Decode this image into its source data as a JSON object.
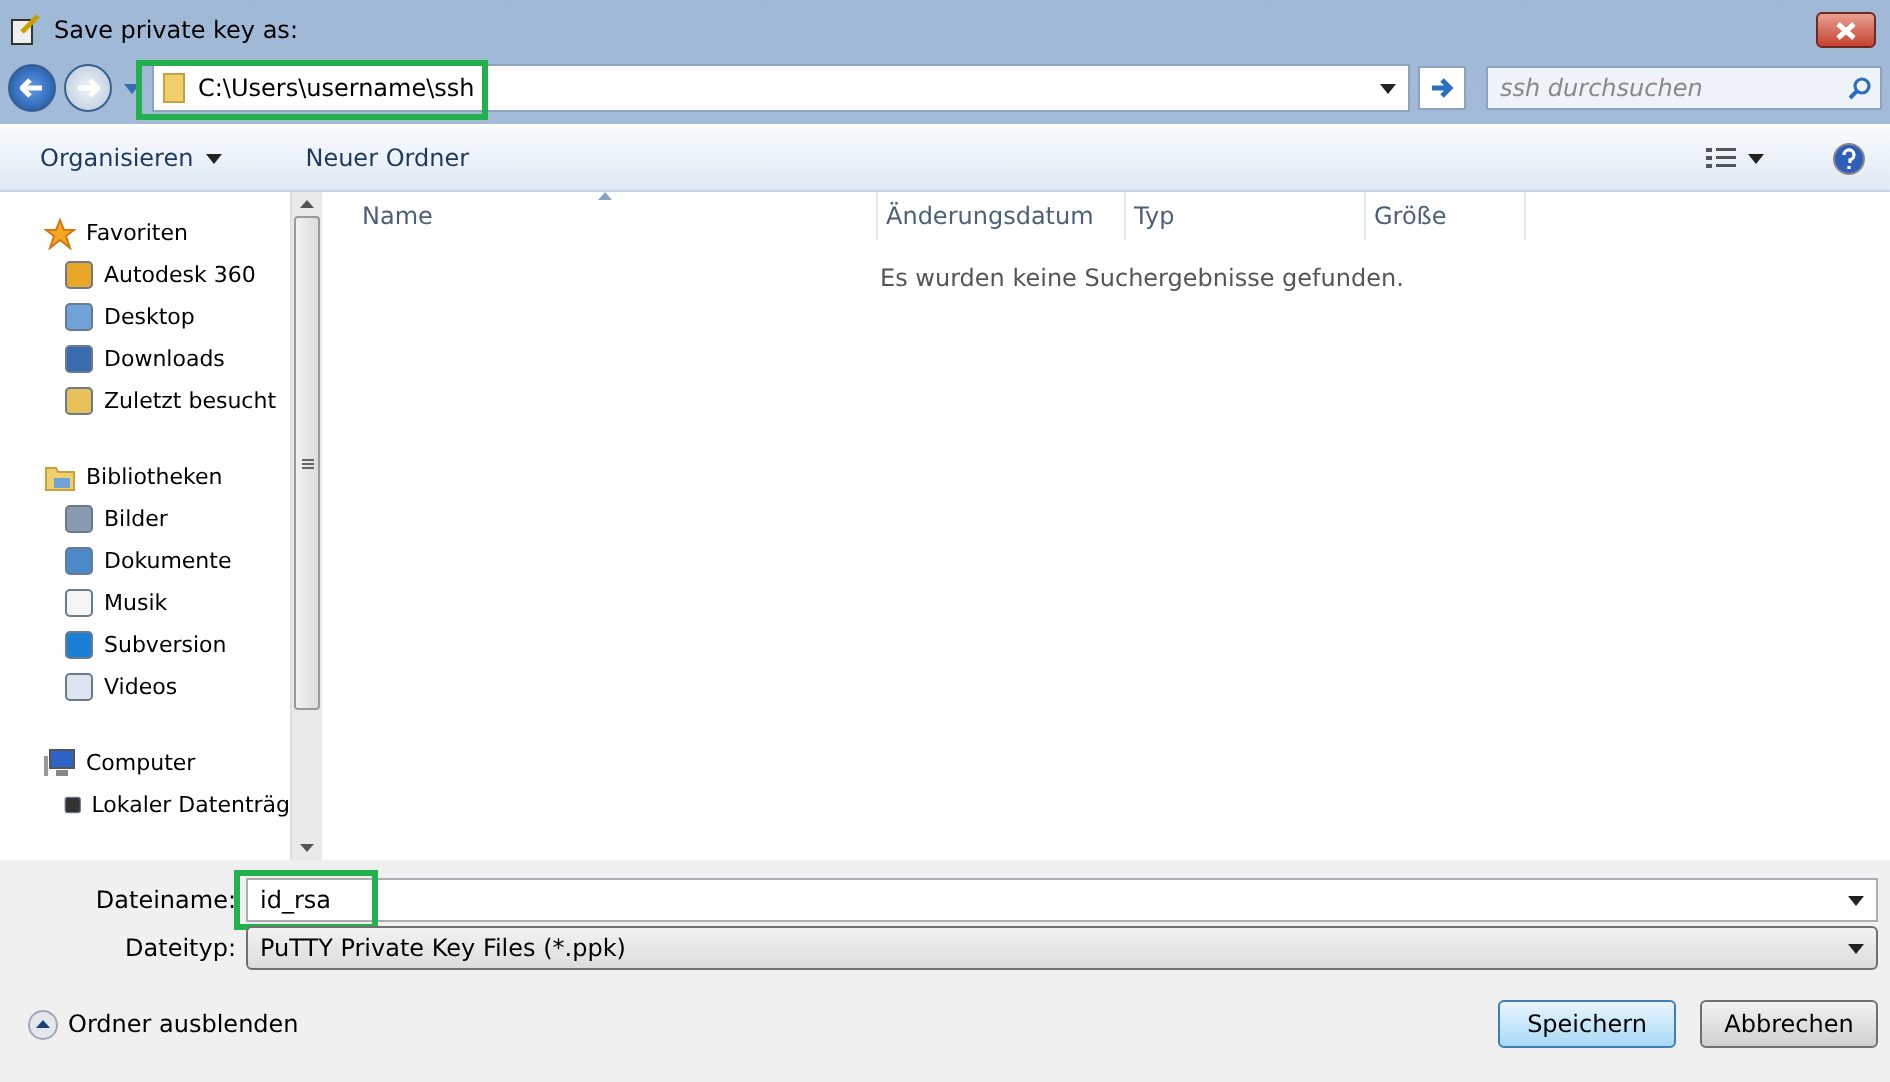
{
  "window": {
    "title": "Save private key as:"
  },
  "address": {
    "value": "C:\\Users\\username\\ssh"
  },
  "search": {
    "placeholder": "ssh durchsuchen"
  },
  "toolbar": {
    "organize": "Organisieren",
    "new_folder": "Neuer Ordner"
  },
  "sidebar": {
    "groups": [
      {
        "label": "Favoriten",
        "children": [
          {
            "label": "Autodesk 360"
          },
          {
            "label": "Desktop"
          },
          {
            "label": "Downloads"
          },
          {
            "label": "Zuletzt besucht"
          }
        ]
      },
      {
        "label": "Bibliotheken",
        "children": [
          {
            "label": "Bilder"
          },
          {
            "label": "Dokumente"
          },
          {
            "label": "Musik"
          },
          {
            "label": "Subversion"
          },
          {
            "label": "Videos"
          }
        ]
      },
      {
        "label": "Computer",
        "children": [
          {
            "label": "Lokaler Datenträg"
          }
        ]
      }
    ]
  },
  "table": {
    "columns": [
      {
        "label": "Name",
        "sorted": true
      },
      {
        "label": "Änderungsdatum",
        "sorted": false
      },
      {
        "label": "Typ",
        "sorted": false
      },
      {
        "label": "Größe",
        "sorted": false
      }
    ],
    "empty_message": "Es wurden keine Suchergebnisse gefunden."
  },
  "form": {
    "filename_label": "Dateiname:",
    "filename": "id_rsa",
    "filetype_label": "Dateityp:",
    "filetype": "PuTTY Private Key Files (*.ppk)"
  },
  "hide_folders": "Ordner ausblenden",
  "buttons": [
    {
      "label": "Speichern",
      "default": true
    },
    {
      "label": "Abbrechen",
      "default": false
    }
  ]
}
